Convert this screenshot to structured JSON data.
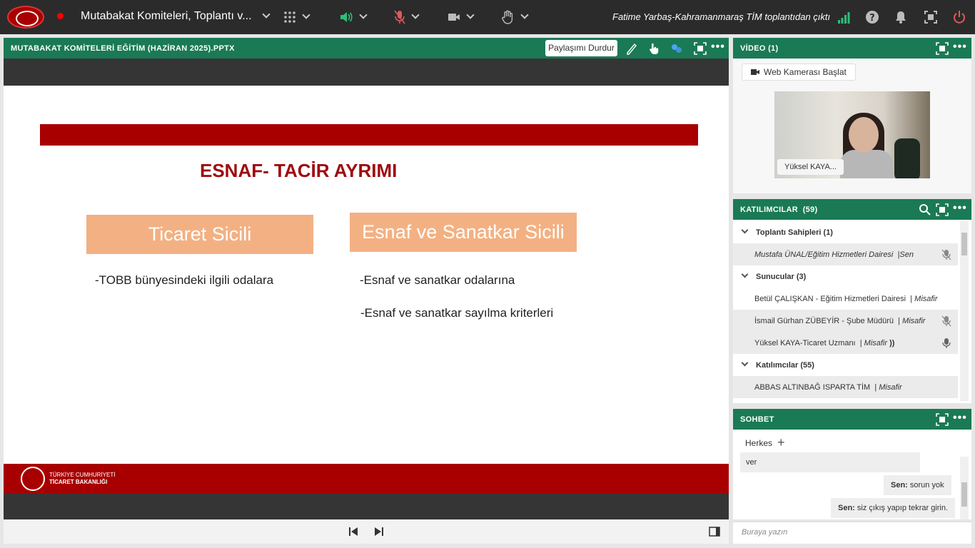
{
  "topbar": {
    "meeting_title": "Mutabakat Komiteleri, Toplantı v...",
    "notification": "Fatime Yarbaş-Kahramanmaraş TİM toplantıdan çıktı"
  },
  "share_pod": {
    "title": "MUTABAKAT KOMİTELERİ EĞİTİM (HAZİRAN 2025).PPTX",
    "stop_share_label": "Paylaşımı Durdur",
    "more_label": "•••"
  },
  "slide": {
    "title": "ESNAF- TACİR AYRIMI",
    "left_box": "Ticaret Sicili",
    "right_box": "Esnaf ve Sanatkar Sicili",
    "left_bullets": [
      "-TOBB bünyesindeki ilgili odalara"
    ],
    "right_bullets": [
      "-Esnaf ve sanatkar odalarına",
      "-Esnaf ve sanatkar sayılma kriterleri"
    ],
    "footer_line1": "TÜRKİYE CUMHURİYETİ",
    "footer_line2": "TİCARET BAKANLIĞI"
  },
  "video_pod": {
    "title": "VİDEO (1)",
    "start_camera_label": "Web Kamerası Başlat",
    "name_tag": "Yüksel KAYA...",
    "more_label": "•••"
  },
  "participants_pod": {
    "title": "KATILIMCILAR  (59)",
    "more_label": "•••",
    "groups": [
      {
        "label": "Toplantı Sahipleri (1)",
        "people": [
          {
            "name": "Mustafa ÜNAL/Eğitim Hizmetleri Dairesi",
            "role": "Sen",
            "mic": "muted"
          }
        ]
      },
      {
        "label": "Sunucular (3)",
        "people": [
          {
            "name": "Betül ÇALIŞKAN - Eğitim Hizmetleri Dairesi",
            "role": "Misafir",
            "mic": "none"
          },
          {
            "name": "İsmail Gürhan ZÜBEYİR - Şube Müdürü",
            "role": "Misafir",
            "mic": "muted"
          },
          {
            "name": "Yüksel KAYA-Ticaret Uzmanı",
            "role": "Misafir",
            "mic": "active"
          }
        ]
      },
      {
        "label": "Katılımcılar (55)",
        "people": [
          {
            "name": "ABBAS ALTINBAĞ ISPARTA TİM",
            "role": "Misafir",
            "mic": "none"
          }
        ]
      }
    ]
  },
  "chat_pod": {
    "title": "SOHBET",
    "more_label": "•••",
    "tab": "Herkes",
    "messages": [
      {
        "sender": "",
        "text": "ver"
      },
      {
        "sender": "Sen:",
        "text": " sorun yok"
      },
      {
        "sender": "Sen:",
        "text": " siz çıkış yapıp tekrar girin."
      }
    ],
    "input_placeholder": "Buraya yazın"
  },
  "colors": {
    "pod_header": "#1a7a55",
    "slide_red": "#a80000",
    "box_orange": "#f3b183",
    "topbar": "#2b2b2b"
  }
}
